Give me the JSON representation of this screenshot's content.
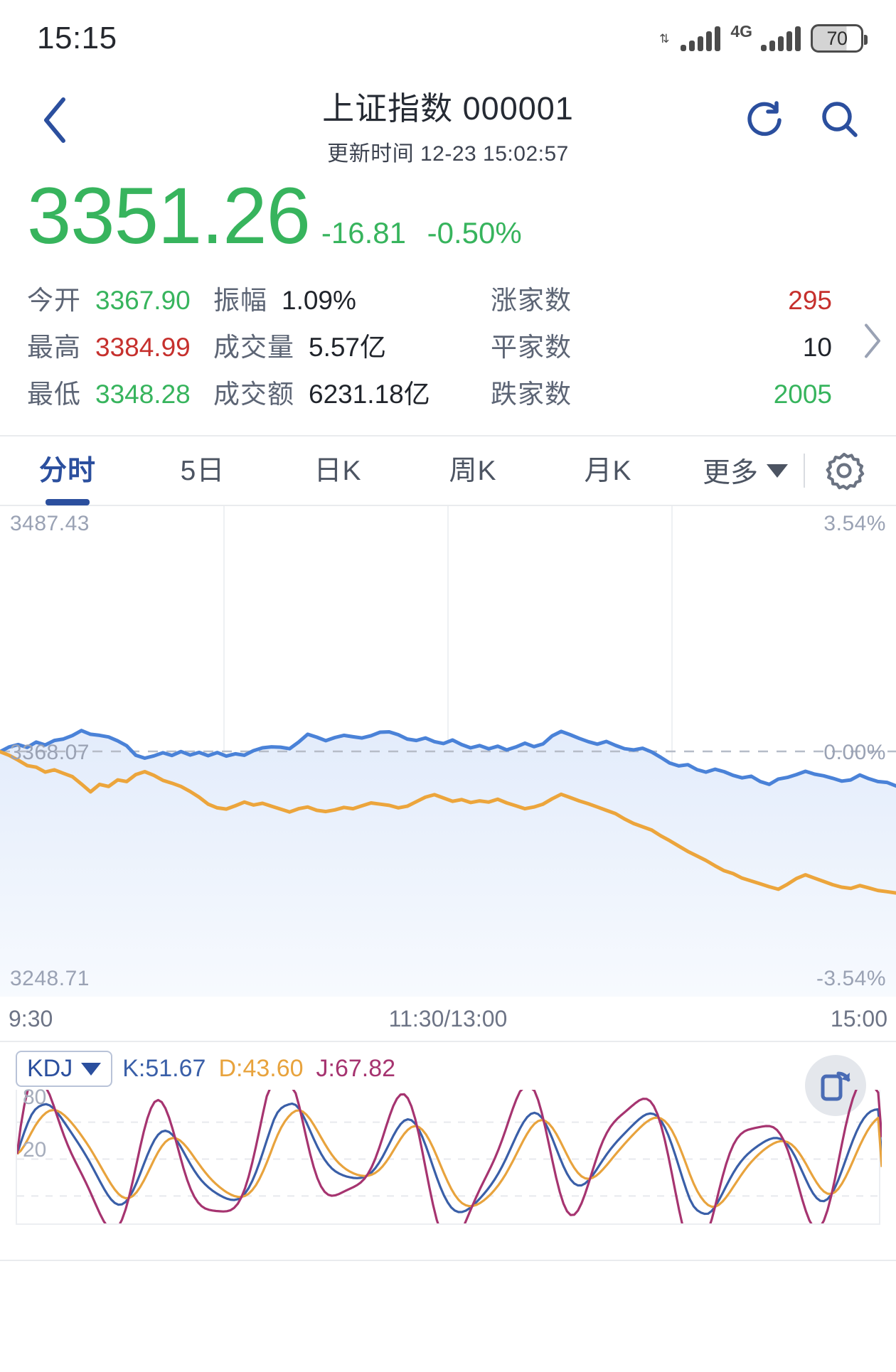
{
  "status_bar": {
    "time": "15:15",
    "network_label": "4G",
    "battery_level": "70",
    "uplink_icon": "data-transfer-icon",
    "signal_icon": "signal-bars-icon"
  },
  "header": {
    "back_icon": "chevron-left-icon",
    "title": "上证指数 000001",
    "subtitle": "更新时间 12-23 15:02:57",
    "refresh_icon": "refresh-icon",
    "search_icon": "search-icon"
  },
  "quote": {
    "price": "3351.26",
    "change": "-16.81",
    "change_pct": "-0.50%",
    "direction_color": "#37b45d"
  },
  "stats": {
    "rows": [
      [
        {
          "label": "今开",
          "value": "3367.90",
          "color": "#37b45d"
        },
        {
          "label": "振幅",
          "value": "1.09%",
          "color": "#20242b"
        },
        {
          "label": "涨家数",
          "value": "295",
          "color": "#c6302d"
        }
      ],
      [
        {
          "label": "最高",
          "value": "3384.99",
          "color": "#c6302d"
        },
        {
          "label": "成交量",
          "value": "5.57亿",
          "color": "#20242b"
        },
        {
          "label": "平家数",
          "value": "10",
          "color": "#20242b"
        }
      ],
      [
        {
          "label": "最低",
          "value": "3348.28",
          "color": "#37b45d"
        },
        {
          "label": "成交额",
          "value": "6231.18亿",
          "color": "#20242b"
        },
        {
          "label": "跌家数",
          "value": "2005",
          "color": "#37b45d"
        }
      ]
    ],
    "expand_icon": "chevron-right-icon"
  },
  "tabs": {
    "items": [
      {
        "label": "分时",
        "active": true
      },
      {
        "label": "5日",
        "active": false
      },
      {
        "label": "日K",
        "active": false
      },
      {
        "label": "周K",
        "active": false
      },
      {
        "label": "月K",
        "active": false
      }
    ],
    "more_label": "更多",
    "more_caret_icon": "chevron-down-icon",
    "settings_icon": "gear-icon",
    "active_color": "#2b4f9e"
  },
  "kdj": {
    "selector_label": "KDJ",
    "selector_caret_icon": "chevron-down-icon",
    "k_text": "K:51.67",
    "d_text": "D:43.60",
    "j_text": "J:67.82",
    "k_value": 51.67,
    "d_value": 43.6,
    "j_value": 67.82,
    "axis_high": "80",
    "axis_low": "20",
    "rotate_icon": "rotate-screen-icon",
    "k_color": "#3a5fa8",
    "d_color": "#e8a33d",
    "j_color": "#a63470"
  },
  "chart_data": {
    "type": "line",
    "title": "上证指数 分时",
    "xlabel": "",
    "ylabel": "",
    "grid": true,
    "legend": "none",
    "axis_top_price": "3487.43",
    "axis_mid_price": "3368.07",
    "axis_bottom_price": "3248.71",
    "axis_top_pct": "3.54%",
    "axis_mid_pct": "0.00%",
    "axis_bottom_pct": "-3.54%",
    "ylim": [
      3248.71,
      3487.43
    ],
    "ylim_pct": [
      -3.54,
      3.54
    ],
    "x_ticks": [
      "9:30",
      "11:30/13:00",
      "15:00"
    ],
    "price_line_color": "#4a82d8",
    "avg_line_color": "#eca53c",
    "fill_color": "#e9f0fc",
    "baseline_color": "#9aa2b4",
    "series": [
      {
        "name": "价格",
        "color": "#4a82d8",
        "values": [
          3367.9,
          3370.2,
          3371.4,
          3370.0,
          3372.6,
          3371.2,
          3373.4,
          3374.1,
          3375.8,
          3378.2,
          3376.4,
          3375.9,
          3375.1,
          3373.2,
          3370.8,
          3366.2,
          3364.8,
          3365.9,
          3367.4,
          3366.1,
          3368.0,
          3366.3,
          3367.6,
          3366.0,
          3367.5,
          3365.8,
          3366.9,
          3366.2,
          3368.4,
          3369.8,
          3370.3,
          3370.1,
          3369.4,
          3372.6,
          3376.4,
          3375.0,
          3373.3,
          3374.8,
          3375.9,
          3375.2,
          3374.6,
          3375.7,
          3377.4,
          3377.6,
          3376.2,
          3374.1,
          3373.4,
          3374.6,
          3372.8,
          3371.9,
          3373.6,
          3371.4,
          3369.8,
          3370.9,
          3369.3,
          3370.6,
          3368.8,
          3370.2,
          3372.1,
          3370.4,
          3371.7,
          3375.6,
          3377.8,
          3376.2,
          3374.4,
          3372.8,
          3371.6,
          3372.9,
          3371.0,
          3369.4,
          3368.8,
          3369.6,
          3367.8,
          3365.2,
          3362.4,
          3361.0,
          3361.6,
          3359.2,
          3358.0,
          3359.4,
          3358.2,
          3356.4,
          3355.2,
          3356.0,
          3353.4,
          3352.0,
          3354.6,
          3355.4,
          3356.8,
          3358.4,
          3357.0,
          3356.2,
          3355.0,
          3353.6,
          3354.2,
          3356.6,
          3354.8,
          3353.4,
          3353.0,
          3351.26
        ]
      },
      {
        "name": "均价",
        "color": "#eca53c",
        "values": [
          3367.9,
          3366.2,
          3363.8,
          3361.2,
          3360.4,
          3358.0,
          3359.1,
          3357.4,
          3355.8,
          3352.2,
          3348.4,
          3352.0,
          3351.0,
          3354.2,
          3353.4,
          3356.8,
          3358.2,
          3356.4,
          3354.0,
          3352.6,
          3351.0,
          3348.6,
          3345.8,
          3342.4,
          3340.6,
          3340.0,
          3341.6,
          3343.4,
          3342.0,
          3342.8,
          3341.4,
          3340.0,
          3338.6,
          3340.2,
          3341.0,
          3339.4,
          3338.8,
          3339.6,
          3340.8,
          3340.2,
          3341.6,
          3343.0,
          3342.4,
          3341.8,
          3340.6,
          3341.4,
          3343.6,
          3345.8,
          3347.0,
          3345.4,
          3343.8,
          3344.6,
          3343.2,
          3344.0,
          3343.4,
          3344.8,
          3343.0,
          3341.6,
          3340.2,
          3341.0,
          3342.4,
          3345.0,
          3347.2,
          3345.6,
          3344.0,
          3342.6,
          3341.0,
          3339.4,
          3337.8,
          3335.2,
          3333.0,
          3331.4,
          3329.8,
          3327.0,
          3324.6,
          3322.0,
          3319.4,
          3317.2,
          3315.0,
          3312.4,
          3310.0,
          3308.6,
          3306.4,
          3305.0,
          3303.6,
          3302.2,
          3301.0,
          3303.4,
          3306.2,
          3308.0,
          3306.4,
          3304.8,
          3303.2,
          3302.0,
          3301.4,
          3302.8,
          3301.6,
          3300.4,
          3299.8,
          3299.2
        ]
      }
    ]
  }
}
